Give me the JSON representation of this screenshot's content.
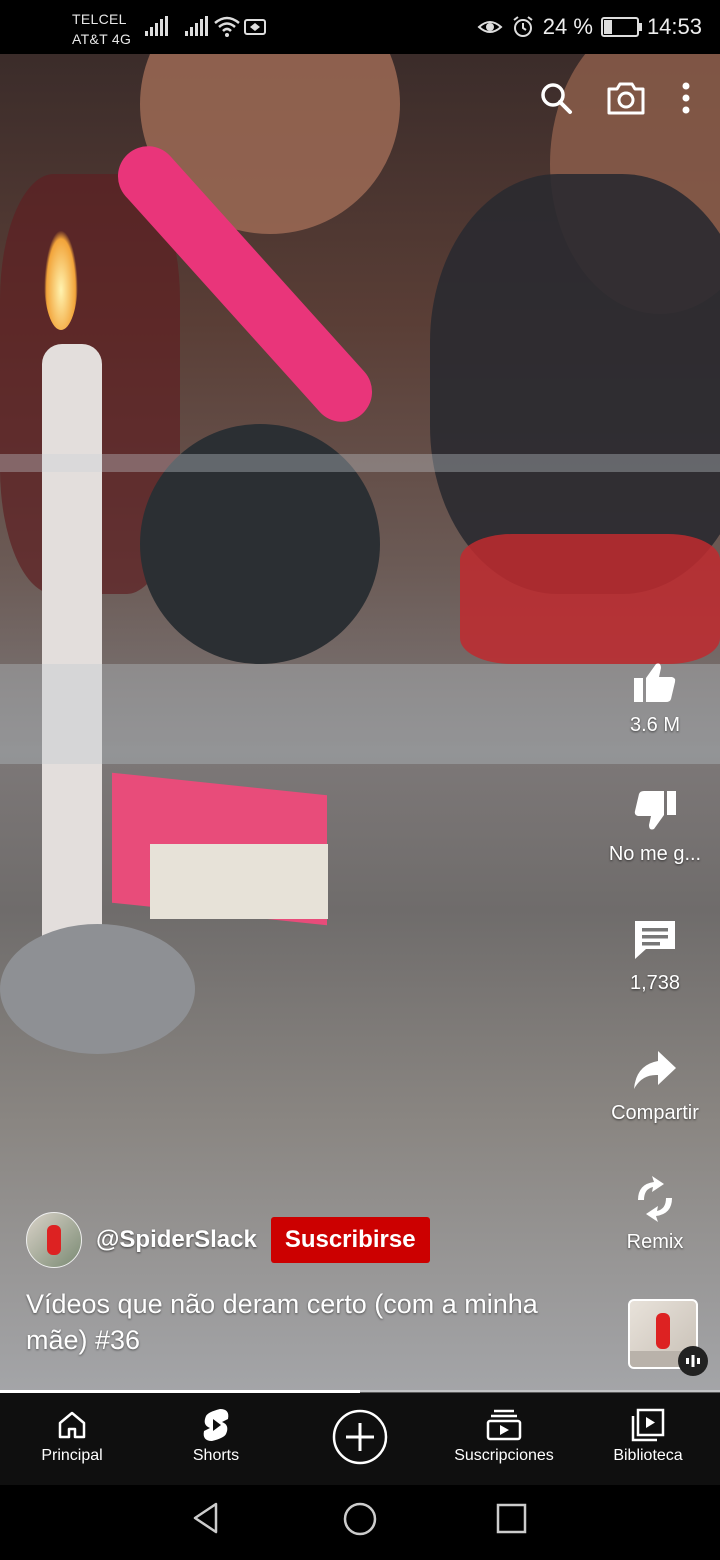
{
  "status_bar": {
    "carrier_line1": "TELCEL",
    "carrier_line2": "AT&T 4G",
    "battery": "24 %",
    "battery_level": 0.24,
    "time": "14:53"
  },
  "top_bar": {
    "icons": [
      "search-icon",
      "camera-icon",
      "more-vertical-icon"
    ]
  },
  "actions": {
    "like_count": "3.6 M",
    "dislike_label": "No me g...",
    "comment_count": "1,738",
    "share_label": "Compartir",
    "remix_label": "Remix"
  },
  "video": {
    "channel_handle": "@SpiderSlack",
    "subscribe_label": "Suscribirse",
    "title": "Vídeos que não deram certo (com a minha mãe) #36",
    "progress": 0.5
  },
  "bottom_nav": {
    "items": [
      {
        "label": "Principal",
        "icon": "home-icon"
      },
      {
        "label": "Shorts",
        "icon": "shorts-icon"
      },
      {
        "label": "",
        "icon": "create-plus-icon"
      },
      {
        "label": "Suscripciones",
        "icon": "subscriptions-icon"
      },
      {
        "label": "Biblioteca",
        "icon": "library-icon"
      }
    ]
  },
  "system_nav": {
    "icons": [
      "back-icon",
      "home-circle-icon",
      "recents-icon"
    ]
  },
  "colors": {
    "subscribe": "#cc0000",
    "nav_bg": "#0f0f0f"
  }
}
